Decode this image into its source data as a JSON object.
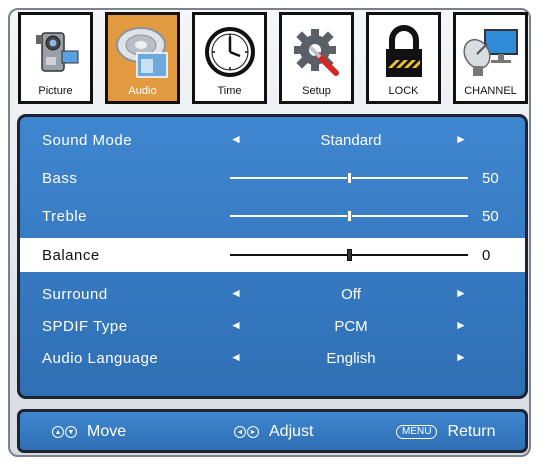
{
  "tabs": [
    {
      "label": "Picture",
      "icon": "camcorder-icon",
      "active": false
    },
    {
      "label": "Audio",
      "icon": "speaker-icon",
      "active": true
    },
    {
      "label": "Time",
      "icon": "clock-icon",
      "active": false
    },
    {
      "label": "Setup",
      "icon": "gear-wrench-icon",
      "active": false
    },
    {
      "label": "LOCK",
      "icon": "padlock-icon",
      "active": false
    },
    {
      "label": "CHANNEL",
      "icon": "satellite-dish-icon",
      "active": false
    }
  ],
  "audio_menu": {
    "sound_mode": {
      "label": "Sound Mode",
      "value": "Standard"
    },
    "bass": {
      "label": "Bass",
      "value": "50",
      "level": 50
    },
    "treble": {
      "label": "Treble",
      "value": "50",
      "level": 50
    },
    "balance": {
      "label": "Balance",
      "value": "0",
      "level": 0
    },
    "surround": {
      "label": "Surround",
      "value": "Off"
    },
    "spdif_type": {
      "label": "SPDIF Type",
      "value": "PCM"
    },
    "audio_language": {
      "label": "Audio Language",
      "value": "English"
    },
    "selected_item": "Balance"
  },
  "footer": {
    "move_label": "Move",
    "adjust_label": "Adjust",
    "menu_key": "MENU",
    "return_label": "Return"
  },
  "colors": {
    "panel_blue": "#3a7cc4",
    "active_tab": "#e29a41",
    "highlight_row": "#ffffff"
  }
}
